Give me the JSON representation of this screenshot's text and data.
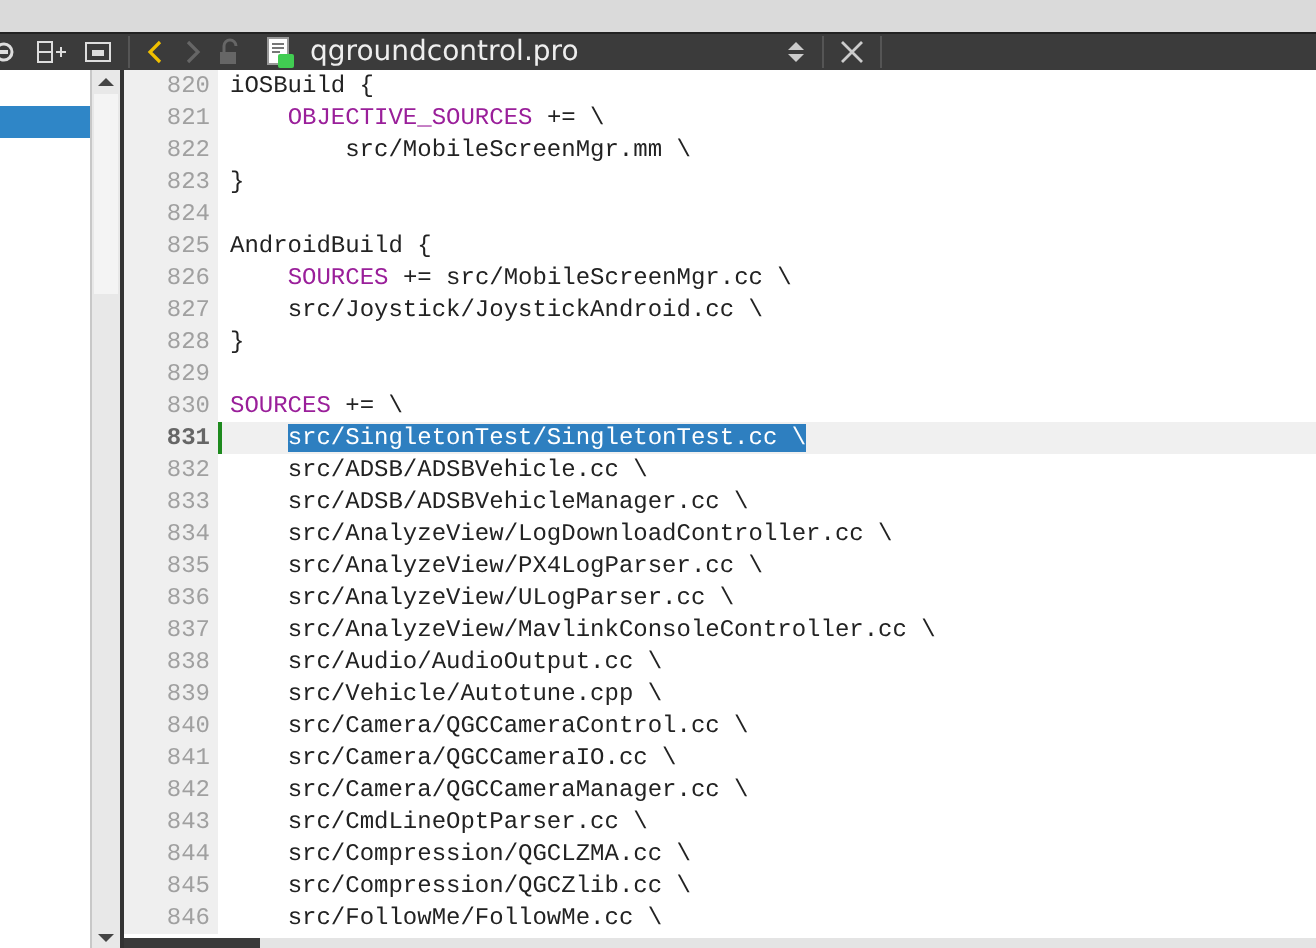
{
  "toolbar": {
    "file_name": "qgroundcontrol.pro",
    "back_enabled": true,
    "forward_enabled": false
  },
  "sidebar": {
    "rows": [
      {
        "selected": true
      }
    ]
  },
  "editor": {
    "lines": [
      {
        "number": "820",
        "current": false,
        "segments": [
          {
            "text": "iOSBuild {",
            "kind": "plain"
          }
        ]
      },
      {
        "number": "821",
        "current": false,
        "segments": [
          {
            "text": "    OBJECTIVE_SOURCES",
            "kind": "keyword"
          },
          {
            "text": " += \\",
            "kind": "plain"
          }
        ]
      },
      {
        "number": "822",
        "current": false,
        "segments": [
          {
            "text": "        src/MobileScreenMgr.mm \\",
            "kind": "plain"
          }
        ]
      },
      {
        "number": "823",
        "current": false,
        "segments": [
          {
            "text": "}",
            "kind": "plain"
          }
        ]
      },
      {
        "number": "824",
        "current": false
      },
      {
        "number": "825",
        "current": false,
        "segments": [
          {
            "text": "AndroidBuild {",
            "kind": "plain"
          }
        ]
      },
      {
        "number": "826",
        "current": false,
        "segments": [
          {
            "text": "    SOURCES",
            "kind": "keyword"
          },
          {
            "text": " += src/MobileScreenMgr.cc \\",
            "kind": "plain"
          }
        ]
      },
      {
        "number": "827",
        "current": false,
        "segments": [
          {
            "text": "    src/Joystick/JoystickAndroid.cc \\",
            "kind": "plain"
          }
        ]
      },
      {
        "number": "828",
        "current": false,
        "segments": [
          {
            "text": "}",
            "kind": "plain"
          }
        ]
      },
      {
        "number": "829",
        "current": false
      },
      {
        "number": "830",
        "current": false,
        "segments": [
          {
            "text": "SOURCES",
            "kind": "keyword"
          },
          {
            "text": " += \\",
            "kind": "plain"
          }
        ]
      },
      {
        "number": "831",
        "current": true,
        "segments": [
          {
            "text": "    src/SingletonTest/SingletonTest.cc \\",
            "kind": "selected"
          }
        ]
      },
      {
        "number": "832",
        "current": false,
        "segments": [
          {
            "text": "    src/ADSB/ADSBVehicle.cc \\",
            "kind": "plain"
          }
        ]
      },
      {
        "number": "833",
        "current": false,
        "segments": [
          {
            "text": "    src/ADSB/ADSBVehicleManager.cc \\",
            "kind": "plain"
          }
        ]
      },
      {
        "number": "834",
        "current": false,
        "segments": [
          {
            "text": "    src/AnalyzeView/LogDownloadController.cc \\",
            "kind": "plain"
          }
        ]
      },
      {
        "number": "835",
        "current": false,
        "segments": [
          {
            "text": "    src/AnalyzeView/PX4LogParser.cc \\",
            "kind": "plain"
          }
        ]
      },
      {
        "number": "836",
        "current": false,
        "segments": [
          {
            "text": "    src/AnalyzeView/ULogParser.cc \\",
            "kind": "plain"
          }
        ]
      },
      {
        "number": "837",
        "current": false,
        "segments": [
          {
            "text": "    src/AnalyzeView/MavlinkConsoleController.cc \\",
            "kind": "plain"
          }
        ]
      },
      {
        "number": "838",
        "current": false,
        "segments": [
          {
            "text": "    src/Audio/AudioOutput.cc \\",
            "kind": "plain"
          }
        ]
      },
      {
        "number": "839",
        "current": false,
        "segments": [
          {
            "text": "    src/Vehicle/Autotune.cpp \\",
            "kind": "plain"
          }
        ]
      },
      {
        "number": "840",
        "current": false,
        "segments": [
          {
            "text": "    src/Camera/QGCCameraControl.cc \\",
            "kind": "plain"
          }
        ]
      },
      {
        "number": "841",
        "current": false,
        "segments": [
          {
            "text": "    src/Camera/QGCCameraIO.cc \\",
            "kind": "plain"
          }
        ]
      },
      {
        "number": "842",
        "current": false,
        "segments": [
          {
            "text": "    src/Camera/QGCCameraManager.cc \\",
            "kind": "plain"
          }
        ]
      },
      {
        "number": "843",
        "current": false,
        "segments": [
          {
            "text": "    src/CmdLineOptParser.cc \\",
            "kind": "plain"
          }
        ]
      },
      {
        "number": "844",
        "current": false,
        "segments": [
          {
            "text": "    src/Compression/QGCLZMA.cc \\",
            "kind": "plain"
          }
        ]
      },
      {
        "number": "845",
        "current": false,
        "segments": [
          {
            "text": "    src/Compression/QGCZlib.cc \\",
            "kind": "plain"
          }
        ]
      },
      {
        "number": "846",
        "current": false,
        "segments": [
          {
            "text": "    src/FollowMe/FollowMe.cc \\",
            "kind": "plain"
          }
        ]
      }
    ]
  }
}
